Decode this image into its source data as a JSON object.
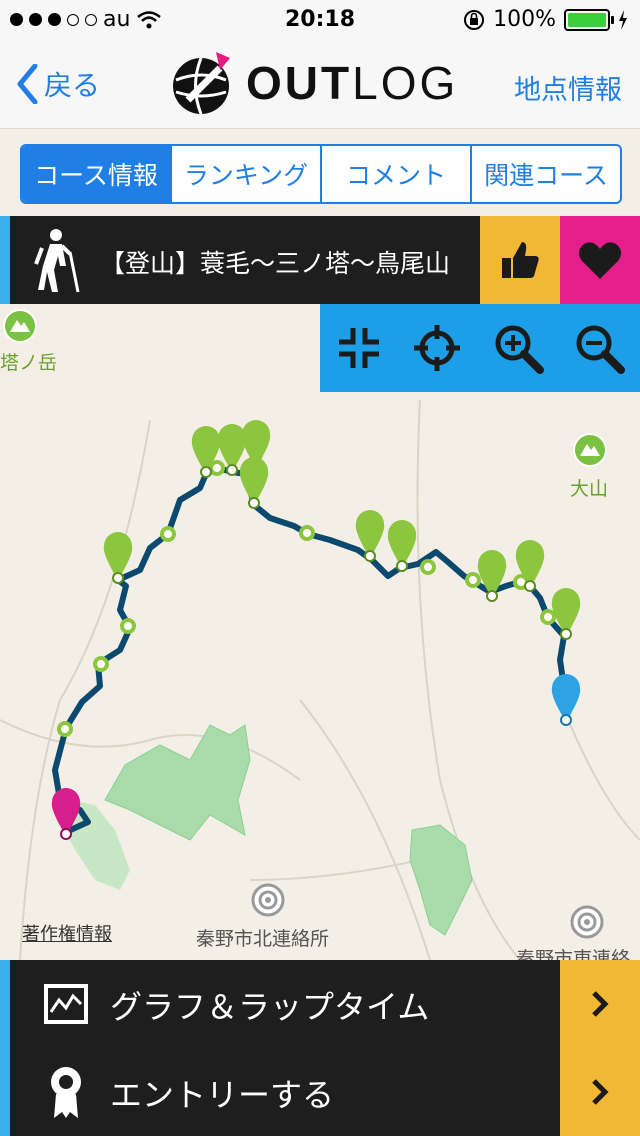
{
  "status": {
    "carrier": "au",
    "time": "20:18",
    "battery": "100%"
  },
  "nav": {
    "back_label": "戻る",
    "logo_text_bold": "OUT",
    "logo_text_light": "LOG",
    "info_label": "地点情報"
  },
  "tabs": [
    {
      "label": "コース情報",
      "active": true
    },
    {
      "label": "ランキング",
      "active": false
    },
    {
      "label": "コメント",
      "active": false
    },
    {
      "label": "関連コース",
      "active": false
    }
  ],
  "course": {
    "title": "【登山】蓑毛〜三ノ塔〜鳥尾山"
  },
  "map": {
    "labels": {
      "peak_left": "塔ノ岳",
      "peak_right": "大山",
      "place1": "秦野市北連絡所",
      "place2": "秦野市東連絡"
    },
    "copyright": "著作権情報"
  },
  "bottom": {
    "graph_label": "グラフ＆ラップタイム",
    "entry_label": "エントリーする"
  },
  "colors": {
    "accent_blue": "#1f7fe5",
    "route": "#0b4a6e",
    "pin_green": "#8cc63f",
    "pin_blue": "#2ea3e4",
    "pin_magenta": "#d61f8c"
  }
}
